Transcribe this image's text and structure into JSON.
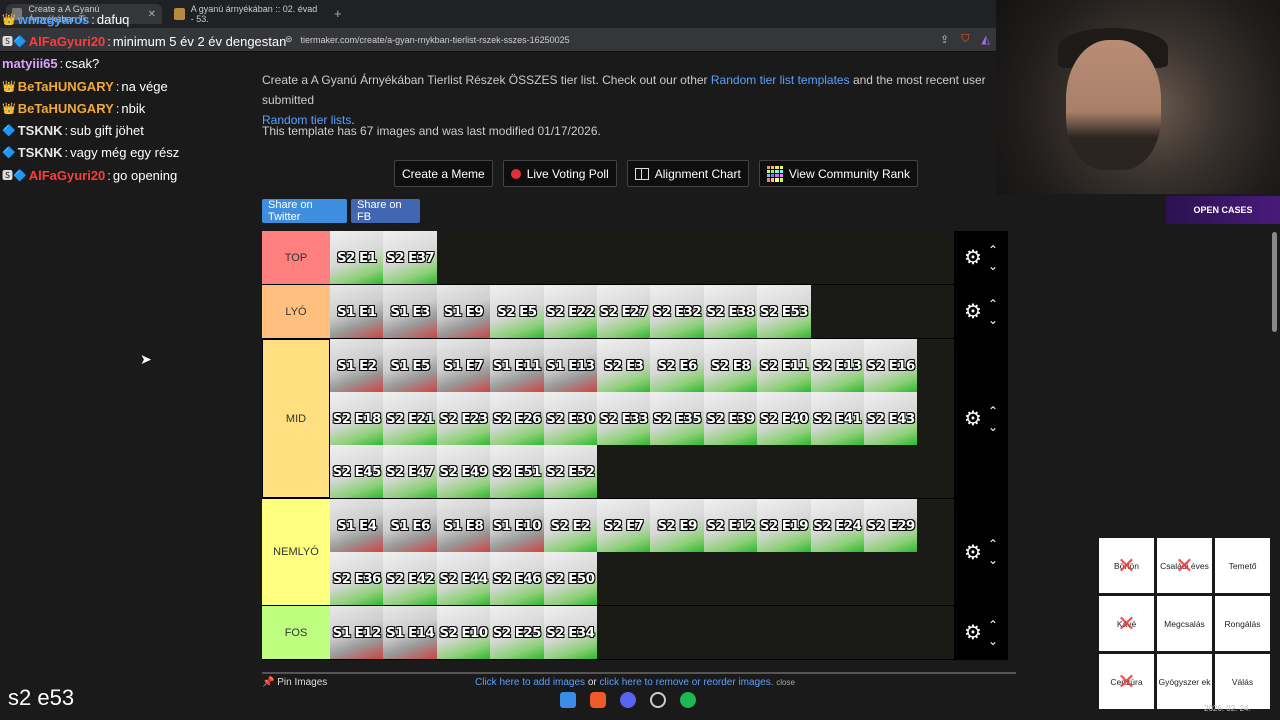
{
  "browser": {
    "tabs": [
      {
        "title": "Create a A Gyanú Árnyékában Ti"
      },
      {
        "title": "A gyanú árnyékában :: 02. évad - 53."
      }
    ],
    "url": "tiermaker.com/create/a-gyan-rnykban-tierlist-rszek-sszes-16250025"
  },
  "chat": [
    {
      "badge": "👑",
      "user": "wmagyaros",
      "color": "#4fa3ff",
      "text": "dafuq"
    },
    {
      "badge": "🆂🔷",
      "user": "AlFaGyuri20",
      "color": "#ff3b3b",
      "text": "minimum 5 év 2 év dengestan"
    },
    {
      "badge": "",
      "user": "matyiii65",
      "color": "#d9a3ff",
      "text": "csak?"
    },
    {
      "badge": "👑",
      "user": "BeTaHUNGARY",
      "color": "#f2a93b",
      "text": "na vége"
    },
    {
      "badge": "👑",
      "user": "BeTaHUNGARY",
      "color": "#f2a93b",
      "text": "nbik"
    },
    {
      "badge": "🔷",
      "user": "TSKNK",
      "color": "#e8e8e8",
      "text": "sub gift jöhet"
    },
    {
      "badge": "🔷",
      "user": "TSKNK",
      "color": "#e8e8e8",
      "text": "vagy még egy rész"
    },
    {
      "badge": "🆂🔷",
      "user": "AlFaGyuri20",
      "color": "#ff3b3b",
      "text": "go opening"
    }
  ],
  "intro": {
    "p1": "Create a A Gyanú Árnyékában Tierlist Részek ÖSSZES tier list. Check out our other ",
    "link1": "Random tier list templates",
    "p2": " and the most recent user submitted ",
    "link2": "Random tier lists",
    "p3": "."
  },
  "template_info": "This template has 67 images and was last modified 01/17/2026.",
  "buttons": {
    "meme": "Create a Meme",
    "poll": "Live Voting Poll",
    "alignment": "Alignment Chart",
    "community": "View Community Rank",
    "twitter": "Share on Twitter",
    "fb": "Share on FB"
  },
  "colors": {
    "twitter": "#3d8ede",
    "fb": "#4267b2",
    "top": "#ff7f7f",
    "lyo": "#ffbf7f",
    "mid": "#ffdf7f",
    "nemlyo": "#ffff7f",
    "fos": "#bfff7f"
  },
  "tiers": [
    {
      "label": "TOP",
      "items": [
        "S2 E1",
        "S2 E37"
      ]
    },
    {
      "label": "LYÓ",
      "items": [
        "S1 E1",
        "S1 E3",
        "S1 E9",
        "S2 E5",
        "S2 E22",
        "S2 E27",
        "S2 E32",
        "S2 E38",
        "S2 E53"
      ]
    },
    {
      "label": "MID",
      "items": [
        "S1 E2",
        "S1 E5",
        "S1 E7",
        "S1 E11",
        "S1 E13",
        "S2 E3",
        "S2 E6",
        "S2 E8",
        "S2 E11",
        "S2 E13",
        "S2 E16",
        "S2 E18",
        "S2 E21",
        "S2 E23",
        "S2 E26",
        "S2 E30",
        "S2 E33",
        "S2 E35",
        "S2 E39",
        "S2 E40",
        "S2 E41",
        "S2 E43",
        "S2 E45",
        "S2 E47",
        "S2 E49",
        "S2 E51",
        "S2 E52"
      ]
    },
    {
      "label": "NEMLYÓ",
      "items": [
        "S1 E4",
        "S1 E6",
        "S1 E8",
        "S1 E10",
        "S2 E2",
        "S2 E7",
        "S2 E9",
        "S2 E12",
        "S2 E19",
        "S2 E24",
        "S2 E29",
        "S2 E36",
        "S2 E42",
        "S2 E44",
        "S2 E46",
        "S2 E50"
      ]
    },
    {
      "label": "FOS",
      "items": [
        "S1 E12",
        "S1 E14",
        "S2 E10",
        "S2 E25",
        "S2 E34"
      ]
    }
  ],
  "bottom": {
    "pin": "Pin Images",
    "add": "Click here to add images",
    "or": " or ",
    "remove": "click here to remove or reorder images.",
    "close": "close"
  },
  "caption": "s2 e53",
  "overlay": {
    "open_cases": "OPEN CASES"
  },
  "bingo": [
    {
      "label": "Börtön",
      "crossed": true
    },
    {
      "label": "Családi éves",
      "crossed": true
    },
    {
      "label": "Temető",
      "crossed": false
    },
    {
      "label": "Kávé",
      "crossed": true
    },
    {
      "label": "Megcsalás",
      "crossed": false
    },
    {
      "label": "Rongálás",
      "crossed": false
    },
    {
      "label": "Cenzúra",
      "crossed": true
    },
    {
      "label": "Gyógyszer ek",
      "crossed": false
    },
    {
      "label": "Válás",
      "crossed": false
    }
  ],
  "clock": "2026. 02. 24."
}
